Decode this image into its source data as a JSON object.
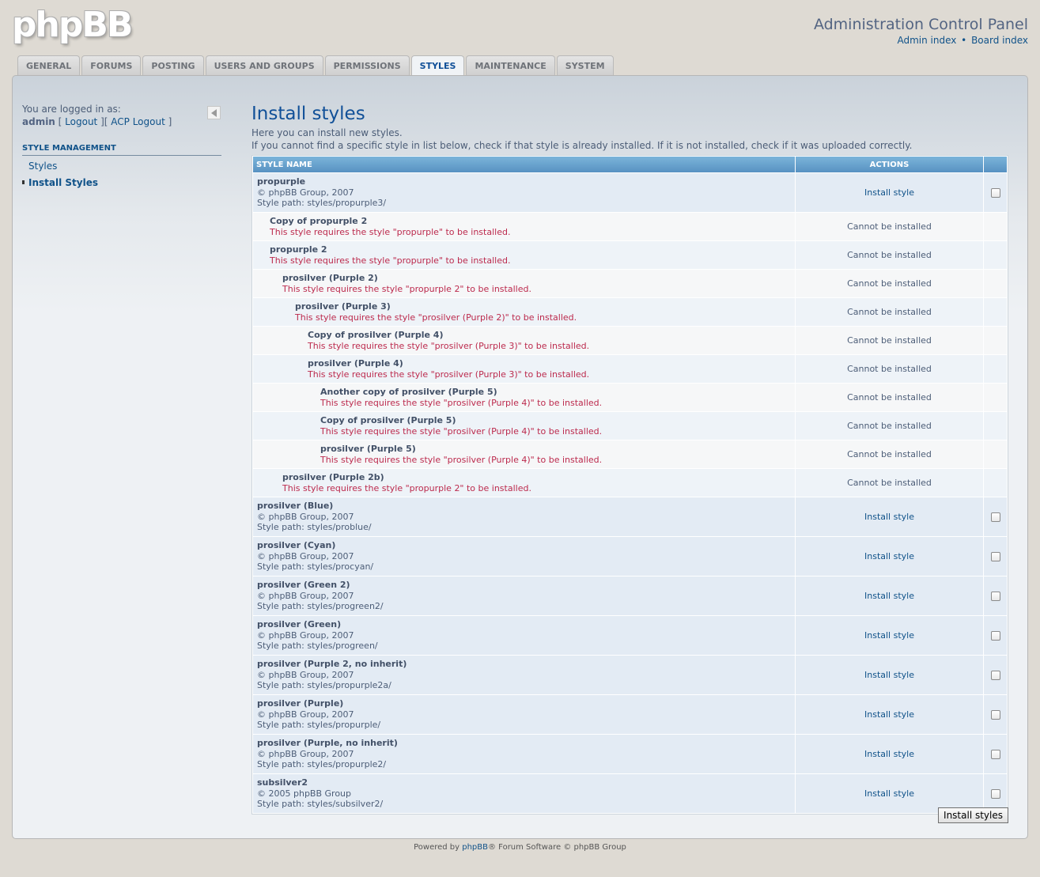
{
  "header": {
    "logo": "phpBB",
    "title": "Administration Control Panel",
    "links": [
      "Admin index",
      "Board index"
    ],
    "link_separator": "•"
  },
  "tabs": [
    {
      "label": "GENERAL",
      "active": false
    },
    {
      "label": "FORUMS",
      "active": false
    },
    {
      "label": "POSTING",
      "active": false
    },
    {
      "label": "USERS AND GROUPS",
      "active": false
    },
    {
      "label": "PERMISSIONS",
      "active": false
    },
    {
      "label": "STYLES",
      "active": true
    },
    {
      "label": "MAINTENANCE",
      "active": false
    },
    {
      "label": "SYSTEM",
      "active": false
    }
  ],
  "sidebar": {
    "logged_in_as": "You are logged in as:",
    "username": "admin",
    "logout": "Logout",
    "acp_logout": "ACP Logout",
    "section": "STYLE MANAGEMENT",
    "items": [
      {
        "label": "Styles",
        "current": false
      },
      {
        "label": "Install Styles",
        "current": true
      }
    ]
  },
  "main": {
    "title": "Install styles",
    "desc1": "Here you can install new styles.",
    "desc2": "If you cannot find a specific style in list below, check if that style is already installed. If it is not installed, check if it was uploaded correctly.",
    "col_name": "STYLE NAME",
    "col_actions": "ACTIONS",
    "install_label": "Install style",
    "cannot_label": "Cannot be installed",
    "submit": "Install styles",
    "rows": [
      {
        "name": "propurple",
        "copyright": "© phpBB Group, 2007",
        "path": "Style path: styles/propurple3/",
        "installable": true,
        "depth": 0
      },
      {
        "name": "Copy of propurple 2",
        "error": "This style requires the style \"propurple\" to be installed.",
        "installable": false,
        "depth": 1
      },
      {
        "name": "propurple 2",
        "error": "This style requires the style \"propurple\" to be installed.",
        "installable": false,
        "depth": 1
      },
      {
        "name": "prosilver (Purple 2)",
        "error": "This style requires the style \"propurple 2\" to be installed.",
        "installable": false,
        "depth": 2
      },
      {
        "name": "prosilver (Purple 3)",
        "error": "This style requires the style \"prosilver (Purple 2)\" to be installed.",
        "installable": false,
        "depth": 3
      },
      {
        "name": "Copy of prosilver (Purple 4)",
        "error": "This style requires the style \"prosilver (Purple 3)\" to be installed.",
        "installable": false,
        "depth": 4
      },
      {
        "name": "prosilver (Purple 4)",
        "error": "This style requires the style \"prosilver (Purple 3)\" to be installed.",
        "installable": false,
        "depth": 4
      },
      {
        "name": "Another copy of prosilver (Purple 5)",
        "error": "This style requires the style \"prosilver (Purple 4)\" to be installed.",
        "installable": false,
        "depth": 5
      },
      {
        "name": "Copy of prosilver (Purple 5)",
        "error": "This style requires the style \"prosilver (Purple 4)\" to be installed.",
        "installable": false,
        "depth": 5
      },
      {
        "name": "prosilver (Purple 5)",
        "error": "This style requires the style \"prosilver (Purple 4)\" to be installed.",
        "installable": false,
        "depth": 5
      },
      {
        "name": "prosilver (Purple 2b)",
        "error": "This style requires the style \"propurple 2\" to be installed.",
        "installable": false,
        "depth": 2
      },
      {
        "name": "prosilver (Blue)",
        "copyright": "© phpBB Group, 2007",
        "path": "Style path: styles/problue/",
        "installable": true,
        "depth": 0
      },
      {
        "name": "prosilver (Cyan)",
        "copyright": "© phpBB Group, 2007",
        "path": "Style path: styles/procyan/",
        "installable": true,
        "depth": 0
      },
      {
        "name": "prosilver (Green 2)",
        "copyright": "© phpBB Group, 2007",
        "path": "Style path: styles/progreen2/",
        "installable": true,
        "depth": 0
      },
      {
        "name": "prosilver (Green)",
        "copyright": "© phpBB Group, 2007",
        "path": "Style path: styles/progreen/",
        "installable": true,
        "depth": 0
      },
      {
        "name": "prosilver (Purple 2, no inherit)",
        "copyright": "© phpBB Group, 2007",
        "path": "Style path: styles/propurple2a/",
        "installable": true,
        "depth": 0
      },
      {
        "name": "prosilver (Purple)",
        "copyright": "© phpBB Group, 2007",
        "path": "Style path: styles/propurple/",
        "installable": true,
        "depth": 0
      },
      {
        "name": "prosilver (Purple, no inherit)",
        "copyright": "© phpBB Group, 2007",
        "path": "Style path: styles/propurple2/",
        "installable": true,
        "depth": 0
      },
      {
        "name": "subsilver2",
        "copyright": "© 2005 phpBB Group",
        "path": "Style path: styles/subsilver2/",
        "installable": true,
        "depth": 0
      }
    ]
  },
  "footer": {
    "prefix": "Powered by ",
    "link": "phpBB",
    "suffix": "® Forum Software © phpBB Group"
  }
}
